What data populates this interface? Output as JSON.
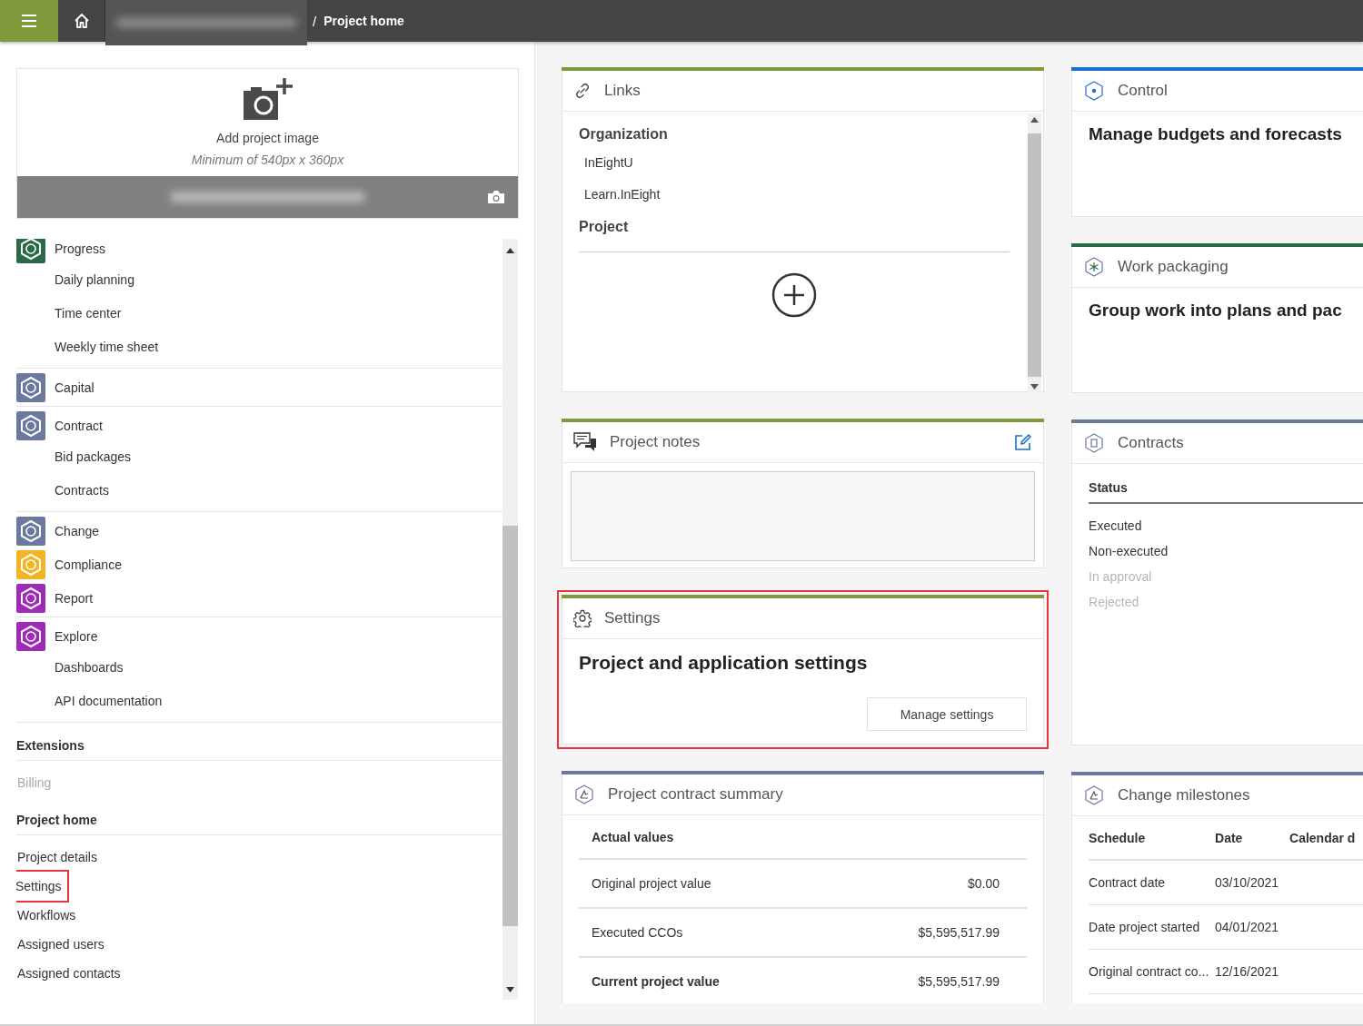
{
  "top_bar": {
    "separator": "/",
    "current_page": "Project home"
  },
  "project_image": {
    "title": "Add project image",
    "hint": "Minimum of 540px x 360px"
  },
  "sidebar": {
    "groups": [
      [
        {
          "label": "Progress",
          "color": "#2b6a49",
          "children": [
            {
              "label": "Daily planning"
            },
            {
              "label": "Time center"
            },
            {
              "label": "Weekly time sheet"
            }
          ]
        }
      ],
      [
        {
          "label": "Capital",
          "color": "#6b78a0"
        }
      ],
      [
        {
          "label": "Contract",
          "color": "#6b78a0",
          "children": [
            {
              "label": "Bid packages"
            },
            {
              "label": "Contracts"
            }
          ]
        }
      ],
      [
        {
          "label": "Change",
          "color": "#6b78a0"
        },
        {
          "label": "Compliance",
          "color": "#f2b324"
        },
        {
          "label": "Report",
          "color": "#a02ab8"
        }
      ],
      [
        {
          "label": "Explore",
          "color": "#a02ab8",
          "children": [
            {
              "label": "Dashboards"
            },
            {
              "label": "API documentation"
            }
          ]
        }
      ]
    ],
    "sections": [
      {
        "heading": "Extensions",
        "items": [
          {
            "label": "Billing",
            "disabled": true,
            "highlighted": false
          }
        ]
      },
      {
        "heading": "Project home",
        "items": [
          {
            "label": "Project details",
            "disabled": false,
            "highlighted": false
          },
          {
            "label": "Settings",
            "disabled": false,
            "highlighted": true
          },
          {
            "label": "Workflows",
            "disabled": false,
            "highlighted": false
          },
          {
            "label": "Assigned users",
            "disabled": false,
            "highlighted": false
          },
          {
            "label": "Assigned contacts",
            "disabled": false,
            "highlighted": false
          }
        ]
      }
    ]
  },
  "cards": {
    "column_1": [
      {
        "kind": "links",
        "title": "Links",
        "color": "#7f9a3a",
        "highlighted": false,
        "sections": [
          {
            "heading": "Organization",
            "links": [
              "InEightU",
              "Learn.InEight"
            ]
          },
          {
            "heading": "Project"
          }
        ]
      },
      {
        "kind": "notes",
        "title": "Project notes",
        "color": "#7f9a3a",
        "highlighted": false
      },
      {
        "kind": "settings",
        "title": "Settings",
        "color": "#7f9a3a",
        "highlighted": true,
        "heading": "Project and application settings",
        "button": "Manage settings"
      },
      {
        "kind": "summary",
        "title": "Project contract summary",
        "color": "#6b78a0",
        "highlighted": false,
        "header": "Actual values",
        "rows": [
          {
            "label": "Original project value",
            "value": "$0.00",
            "total": false
          },
          {
            "label": "Executed CCOs",
            "value": "$5,595,517.99",
            "total": false
          },
          {
            "label": "Current project value",
            "value": "$5,595,517.99",
            "total": true
          }
        ]
      }
    ],
    "column_2": [
      {
        "kind": "intro",
        "title": "Control",
        "color": "#1a6fcf",
        "highlighted": false,
        "heading": "Manage budgets and forecasts"
      },
      {
        "kind": "intro",
        "title": "Work packaging",
        "color": "#2b6a49",
        "highlighted": false,
        "heading": "Group work into plans and pac"
      },
      {
        "kind": "status",
        "title": "Contracts",
        "color": "#6b78a0",
        "highlighted": false,
        "header": "Status",
        "items": [
          {
            "label": "Executed",
            "disabled": false
          },
          {
            "label": "Non-executed",
            "disabled": false
          },
          {
            "label": "In approval",
            "disabled": true
          },
          {
            "label": "Rejected",
            "disabled": true
          }
        ]
      },
      {
        "kind": "milestones",
        "title": "Change milestones",
        "color": "#6b78a0",
        "highlighted": false,
        "columns": [
          "Schedule",
          "Date",
          "Calendar d"
        ],
        "rows": [
          [
            "Contract date",
            "03/10/2021"
          ],
          [
            "Date project started",
            "04/01/2021"
          ],
          [
            "Original contract co...",
            "12/16/2021"
          ]
        ]
      }
    ]
  }
}
